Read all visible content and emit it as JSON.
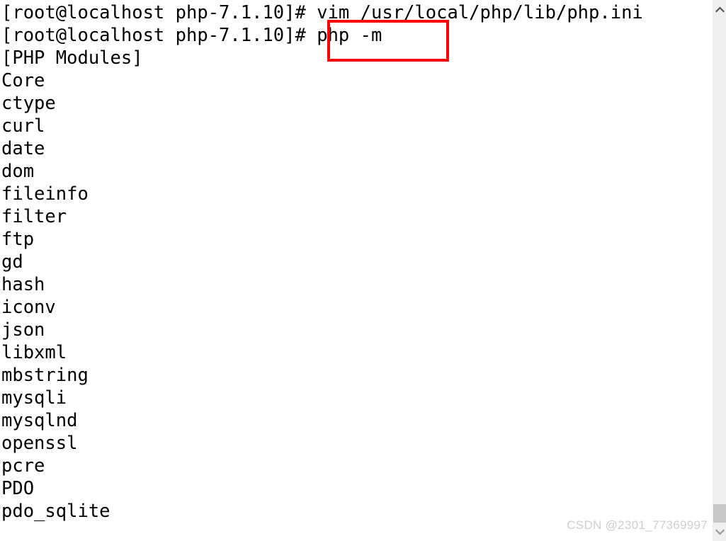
{
  "terminal": {
    "prompt": "[root@localhost php-7.1.10]#",
    "lines": [
      "[root@localhost php-7.1.10]# vim /usr/local/php/lib/php.ini",
      "[root@localhost php-7.1.10]# php -m",
      "[PHP Modules]",
      "Core",
      "ctype",
      "curl",
      "date",
      "dom",
      "fileinfo",
      "filter",
      "ftp",
      "gd",
      "hash",
      "iconv",
      "json",
      "libxml",
      "mbstring",
      "mysqli",
      "mysqlnd",
      "openssl",
      "pcre",
      "PDO",
      "pdo_sqlite"
    ],
    "commands": {
      "vim_command": "vim /usr/local/php/lib/php.ini",
      "php_modules_command": "php -m"
    },
    "modules_header": "[PHP Modules]",
    "modules": [
      "Core",
      "ctype",
      "curl",
      "date",
      "dom",
      "fileinfo",
      "filter",
      "ftp",
      "gd",
      "hash",
      "iconv",
      "json",
      "libxml",
      "mbstring",
      "mysqli",
      "mysqlnd",
      "openssl",
      "pcre",
      "PDO",
      "pdo_sqlite"
    ],
    "text_color": "#000000",
    "background_color": "#ffffff"
  },
  "annotation": {
    "highlighted_text": "php -m",
    "color": "#ff0000"
  },
  "watermark": {
    "text": "CSDN @2301_77369997",
    "color": "#cfcfcf"
  },
  "scrollbar": {
    "up_arrow": "chevron-up",
    "down_arrow": "chevron-down",
    "track_color": "#f0f0f0",
    "thumb_color": "#c8c8c8"
  }
}
